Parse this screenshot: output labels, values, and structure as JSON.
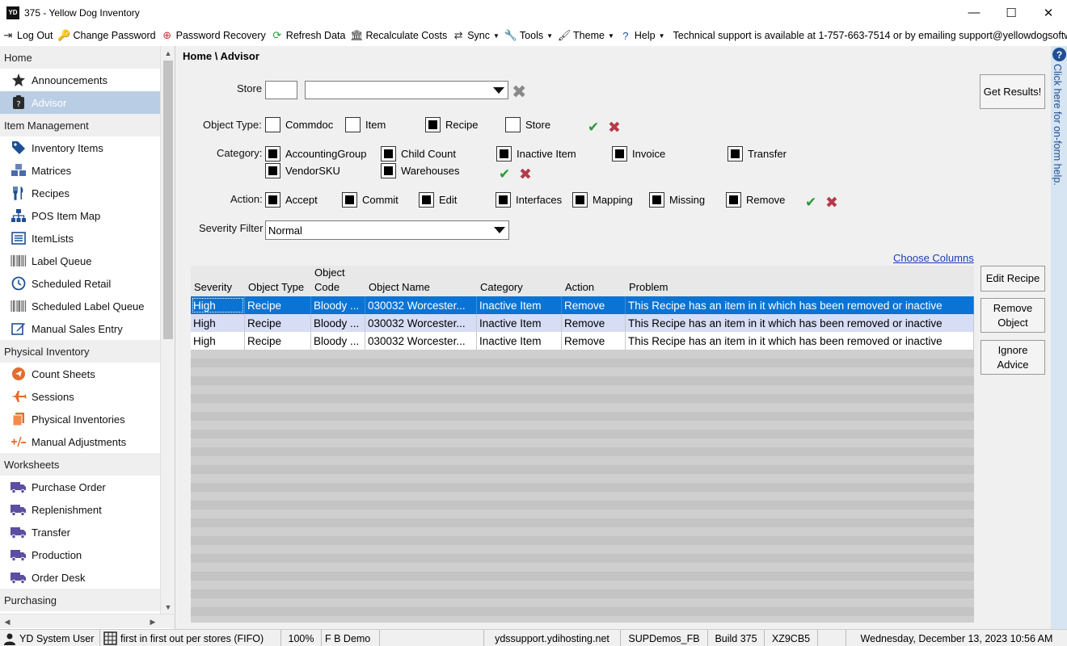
{
  "window": {
    "app_icon": "YD",
    "title": "375  - Yellow Dog Inventory",
    "minimize": "—",
    "maximize": "☐",
    "close": "✕"
  },
  "menubar": {
    "items": [
      {
        "label": "Log Out",
        "icon": "logout-icon",
        "glyph": "⇥",
        "color": "#222"
      },
      {
        "label": "Change Password",
        "icon": "key-icon",
        "glyph": "🔑",
        "color": "#c9a040"
      },
      {
        "label": "Password Recovery",
        "icon": "lifebuoy-icon",
        "glyph": "⊕",
        "color": "#d03030"
      },
      {
        "label": "Refresh Data",
        "icon": "refresh-icon",
        "glyph": "⟳",
        "color": "#2a9a3a"
      },
      {
        "label": "Recalculate Costs",
        "icon": "bank-icon",
        "glyph": "🏛",
        "color": "#333"
      },
      {
        "label": "Sync",
        "icon": "sync-arrows-icon",
        "glyph": "⇄",
        "color": "#333",
        "dropdown": true
      },
      {
        "label": "Tools",
        "icon": "wrench-icon",
        "glyph": "🔧",
        "color": "#333",
        "dropdown": true
      },
      {
        "label": "Theme",
        "icon": "paint-brush-icon",
        "glyph": "🖌",
        "color": "#333",
        "dropdown": true
      },
      {
        "label": "Help",
        "icon": "help-circle-icon",
        "glyph": "?",
        "color": "#1f4f93",
        "dropdown": true
      }
    ],
    "support_text": "Technical support is available at 1-757-663-7514 or by emailing support@yellowdogsoftware.com."
  },
  "sidebar": {
    "entries": [
      {
        "type": "group",
        "label": "Home"
      },
      {
        "type": "item",
        "label": "Announcements",
        "icon": "star-badge-icon"
      },
      {
        "type": "item",
        "label": "Advisor",
        "icon": "clipboard-question-icon",
        "selected": true
      },
      {
        "type": "group",
        "label": "Item Management"
      },
      {
        "type": "item",
        "label": "Inventory Items",
        "icon": "tag-icon"
      },
      {
        "type": "item",
        "label": "Matrices",
        "icon": "cubes-icon"
      },
      {
        "type": "item",
        "label": "Recipes",
        "icon": "fork-knife-icon"
      },
      {
        "type": "item",
        "label": "POS Item Map",
        "icon": "sitemap-icon"
      },
      {
        "type": "item",
        "label": "ItemLists",
        "icon": "list-icon"
      },
      {
        "type": "item",
        "label": "Label Queue",
        "icon": "barcode-icon"
      },
      {
        "type": "item",
        "label": "Scheduled Retail",
        "icon": "clock-icon"
      },
      {
        "type": "item",
        "label": "Scheduled Label Queue",
        "icon": "barcode-icon"
      },
      {
        "type": "item",
        "label": "Manual Sales Entry",
        "icon": "edit-icon"
      },
      {
        "type": "group",
        "label": "Physical Inventory"
      },
      {
        "type": "item",
        "label": "Count Sheets",
        "icon": "send-circle-icon"
      },
      {
        "type": "item",
        "label": "Sessions",
        "icon": "plane-icon"
      },
      {
        "type": "item",
        "label": "Physical Inventories",
        "icon": "copy-icon"
      },
      {
        "type": "item",
        "label": "Manual Adjustments",
        "icon": "plus-minus-icon"
      },
      {
        "type": "group",
        "label": "Worksheets"
      },
      {
        "type": "item",
        "label": "Purchase Order",
        "icon": "truck-icon"
      },
      {
        "type": "item",
        "label": "Replenishment",
        "icon": "truck-icon"
      },
      {
        "type": "item",
        "label": "Transfer",
        "icon": "truck-icon"
      },
      {
        "type": "item",
        "label": "Production",
        "icon": "truck-icon"
      },
      {
        "type": "item",
        "label": "Order Desk",
        "icon": "truck-icon"
      },
      {
        "type": "group",
        "label": "Purchasing"
      }
    ]
  },
  "main": {
    "breadcrumb": "Home \\ Advisor",
    "store_label": "Store",
    "store_code": "",
    "store_name": "",
    "object_type_label": "Object Type:",
    "object_types": [
      {
        "label": "Commdoc",
        "checked": false
      },
      {
        "label": "Item",
        "checked": false
      },
      {
        "label": "Recipe",
        "checked": true
      },
      {
        "label": "Store",
        "checked": false
      }
    ],
    "category_label": "Category:",
    "categories": [
      {
        "label": "AccountingGroup",
        "checked": true
      },
      {
        "label": "Child Count",
        "checked": true
      },
      {
        "label": "Inactive Item",
        "checked": true
      },
      {
        "label": "Invoice",
        "checked": true
      },
      {
        "label": "Transfer",
        "checked": true
      },
      {
        "label": "VendorSKU",
        "checked": true
      },
      {
        "label": "Warehouses",
        "checked": true
      }
    ],
    "action_label": "Action:",
    "actions": [
      {
        "label": "Accept",
        "checked": true
      },
      {
        "label": "Commit",
        "checked": true
      },
      {
        "label": "Edit",
        "checked": true
      },
      {
        "label": "Interfaces",
        "checked": true
      },
      {
        "label": "Mapping",
        "checked": true
      },
      {
        "label": "Missing",
        "checked": true
      },
      {
        "label": "Remove",
        "checked": true
      }
    ],
    "check_all_glyph": "✔",
    "uncheck_all_glyph": "✖",
    "clear_glyph": "✖",
    "severity_label": "Severity Filter",
    "severity_value": "Normal",
    "get_results": "Get Results!",
    "choose_columns": "Choose Columns",
    "edit_recipe": "Edit Recipe",
    "remove_object": "Remove Object",
    "ignore_advice": "Ignore Advice",
    "grid": {
      "columns": [
        "Severity",
        "Object Type",
        "Object Code",
        "Object Name",
        "Category",
        "Action",
        "Problem"
      ],
      "rows": [
        [
          "High",
          "Recipe",
          "Bloody ...",
          "030032 Worcester...",
          "Inactive Item",
          "Remove",
          "This Recipe has an item in it which has been removed or inactive"
        ],
        [
          "High",
          "Recipe",
          "Bloody ...",
          "030032 Worcester...",
          "Inactive Item",
          "Remove",
          "This Recipe has an item in it which has been removed or inactive"
        ],
        [
          "High",
          "Recipe",
          "Bloody ...",
          "030032 Worcester...",
          "Inactive Item",
          "Remove",
          "This Recipe has an item in it which has been removed or inactive"
        ]
      ]
    }
  },
  "help_strip": {
    "glyph": "?",
    "text": "Click here for on-form help."
  },
  "statusbar": {
    "user": "YD System User",
    "costing": "first in first out per stores (FIFO)",
    "zoom": "100%",
    "company": "F B Demo",
    "server": "ydssupport.ydihosting.net",
    "database": "SUPDemos_FB",
    "build": "Build 375",
    "code": "XZ9CB5",
    "datetime": "Wednesday, December 13, 2023 10:56 AM"
  },
  "colors": {
    "selected_row": "#0b73d3",
    "alt_row": "#d6ddf5",
    "sidebar_selected": "#b9cde4",
    "check_ok": "#2a9a3a",
    "check_x": "#b53a4b"
  }
}
